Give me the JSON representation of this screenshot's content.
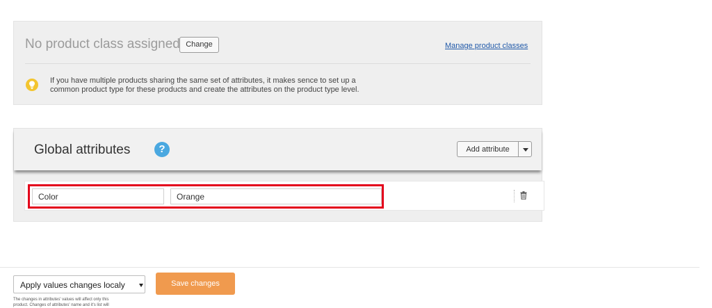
{
  "product_class": {
    "title": "No product class assigned",
    "change_label": "Change",
    "manage_link": "Manage product classes",
    "hint_line1": "If you have multiple products sharing the same set of attributes, it makes sence to set up a",
    "hint_line2": "common product type for these products and create the attributes on the product type level.",
    "hint_icon": "lightbulb-icon"
  },
  "global_attributes": {
    "title": "Global attributes",
    "help_symbol": "?",
    "add_label": "Add attribute",
    "rows": [
      {
        "name": "Color",
        "value": "Orange"
      }
    ]
  },
  "footer": {
    "apply_select_value": "Apply values changes localy",
    "save_label": "Save changes",
    "note_line1": "The changes in attributes' values will affect only this",
    "note_line2": "product. Changes of attributes' name and it's list will"
  },
  "colors": {
    "accent_save": "#f09a4e",
    "highlight": "#e3001b",
    "help": "#4aa8e0",
    "bulb": "#f3c52f"
  }
}
